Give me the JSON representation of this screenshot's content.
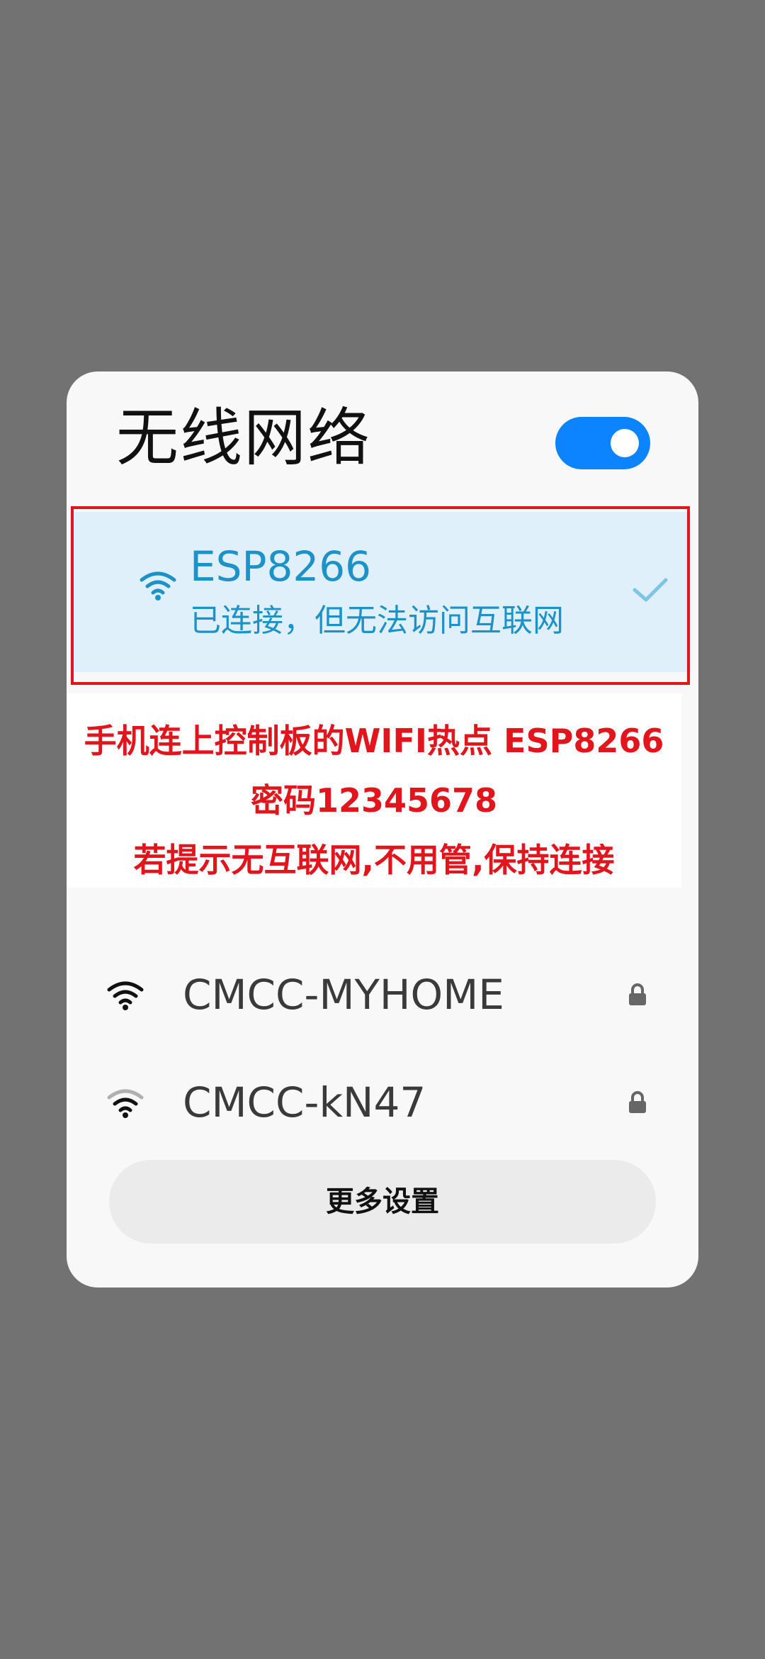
{
  "panel": {
    "title": "无线网络",
    "toggle_state": "on",
    "accent_color": "#0d84ff"
  },
  "connected_network": {
    "name": "ESP8266",
    "status": "已连接，但无法访问互联网",
    "icon": "wifi-icon",
    "selected_icon": "check-icon"
  },
  "notice": {
    "color": "#e2151d",
    "lines": [
      "手机连上控制板的WIFI热点 ESP8266",
      "密码12345678",
      "若提示无互联网,不用管,保持连接"
    ]
  },
  "networks": [
    {
      "name": "CMCC-MYHOME",
      "icon": "wifi-icon",
      "secured": true,
      "lock_icon": "lock-icon"
    },
    {
      "name": "CMCC-kN47",
      "icon": "wifi-icon",
      "secured": true,
      "lock_icon": "lock-icon"
    }
  ],
  "more_settings_label": "更多设置"
}
